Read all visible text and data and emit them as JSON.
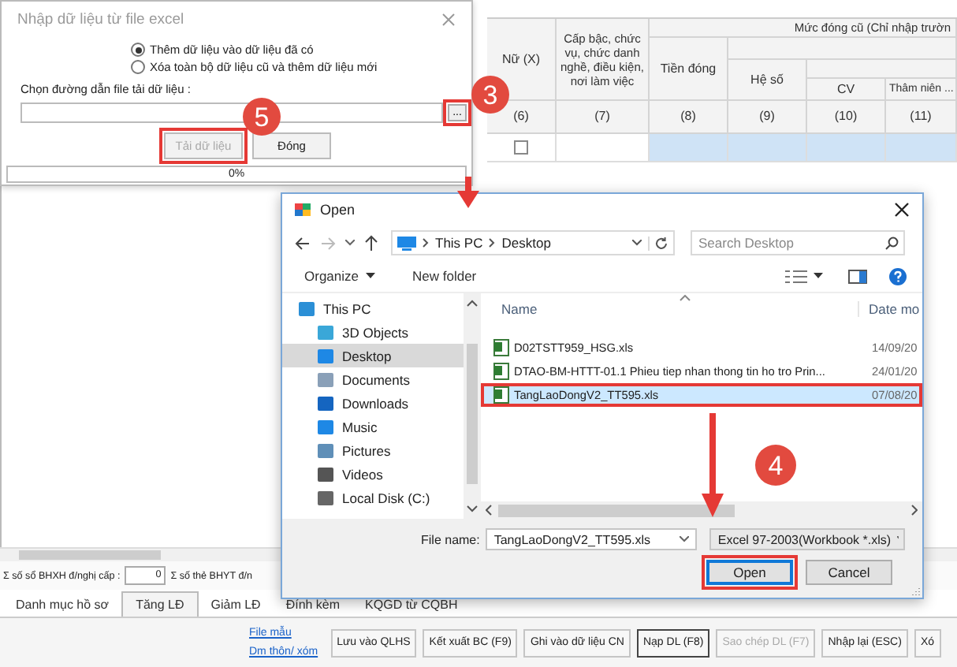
{
  "background_app": {
    "table": {
      "group_header": "Mức đóng cũ (Chỉ nhập trườn",
      "columns": [
        {
          "label": "Nữ (X)",
          "number": "(6)"
        },
        {
          "label": "Cấp bậc, chức vụ, chức danh nghề, điều kiện, nơi làm việc",
          "number": "(7)"
        },
        {
          "label": "Tiền đóng",
          "number": "(8)"
        },
        {
          "label": "Hệ số",
          "number": "(9)"
        },
        {
          "label": "CV",
          "number": "(10)"
        },
        {
          "label": "Thâm niên ...",
          "number": "(11)"
        }
      ],
      "row": {
        "female_checked": false
      }
    },
    "totals": [
      {
        "label": "Σ số sổ BHXH đ/nghị cấp :",
        "value": "0"
      },
      {
        "label": "Σ số thẻ BHYT đ/n"
      }
    ],
    "tabs": [
      {
        "label": "Danh mục hồ sơ",
        "selected": false
      },
      {
        "label": "Tăng LĐ",
        "selected": true
      },
      {
        "label": "Giảm LĐ",
        "selected": false
      },
      {
        "label": "Đính kèm",
        "selected": false
      },
      {
        "label": "KQGD từ CQBH",
        "selected": false
      }
    ],
    "links": [
      "File mẫu",
      "Dm thôn/ xóm"
    ],
    "buttons": [
      {
        "label": "Lưu vào QLHS",
        "disabled": false,
        "focused": false
      },
      {
        "label": "Kết xuất BC (F9)",
        "disabled": false,
        "focused": false
      },
      {
        "label": "Ghi vào dữ liệu CN",
        "disabled": false,
        "focused": false
      },
      {
        "label": "Nạp DL (F8)",
        "disabled": false,
        "focused": true
      },
      {
        "label": "Sao chép DL (F7)",
        "disabled": true,
        "focused": false
      },
      {
        "label": "Nhập lại (ESC)",
        "disabled": false,
        "focused": false
      },
      {
        "label": "Xó",
        "disabled": false,
        "focused": false
      }
    ]
  },
  "import_dialog": {
    "title": "Nhập dữ liệu từ file excel",
    "options": [
      {
        "label": "Thêm dữ liệu vào dữ liệu đã có",
        "selected": true
      },
      {
        "label": "Xóa toàn bộ dữ liệu cũ và thêm dữ liệu mới",
        "selected": false
      }
    ],
    "path_label": "Chọn đường dẫn file tải dữ liệu :",
    "browse_button": {
      "label": "...",
      "highlighted": true
    },
    "buttons": [
      {
        "label": "Tải dữ liệu",
        "disabled": true,
        "highlighted": true
      },
      {
        "label": "Đóng",
        "disabled": false,
        "highlighted": false
      }
    ],
    "progress": {
      "level": 0,
      "reading": "0%"
    }
  },
  "open_dialog": {
    "title": "Open",
    "breadcrumb": [
      "This PC",
      "Desktop"
    ],
    "search": {
      "placeholder": "Search Desktop"
    },
    "toolbar": [
      "Organize",
      "New folder"
    ],
    "nav_items": [
      {
        "label": "This PC",
        "selected": false
      },
      {
        "label": "3D Objects",
        "selected": false
      },
      {
        "label": "Desktop",
        "selected": true
      },
      {
        "label": "Documents",
        "selected": false
      },
      {
        "label": "Downloads",
        "selected": false
      },
      {
        "label": "Music",
        "selected": false
      },
      {
        "label": "Pictures",
        "selected": false
      },
      {
        "label": "Videos",
        "selected": false
      },
      {
        "label": "Local Disk (C:)",
        "selected": false
      }
    ],
    "columns": [
      "Name",
      "Date mo"
    ],
    "files": [
      {
        "name": "D02TSTT959_HSG.xls",
        "date": "14/09/20",
        "selected": false,
        "highlighted": false
      },
      {
        "name": "DTAO-BM-HTTT-01.1 Phieu tiep nhan thong tin ho tro Prin...",
        "date": "24/01/20",
        "selected": false,
        "highlighted": false
      },
      {
        "name": "TangLaoDongV2_TT595.xls",
        "date": "07/08/20",
        "selected": true,
        "highlighted": true
      }
    ],
    "file_name_label": "File name:",
    "file_name": {
      "value": "TangLaoDongV2_TT595.xls"
    },
    "file_type": {
      "value": "Excel 97-2003(Workbook *.xls)"
    },
    "buttons": [
      {
        "label": "Open",
        "default": true,
        "highlighted": true
      },
      {
        "label": "Cancel",
        "default": false,
        "highlighted": false
      }
    ]
  },
  "step_badges": [
    "5",
    "3",
    "4"
  ]
}
